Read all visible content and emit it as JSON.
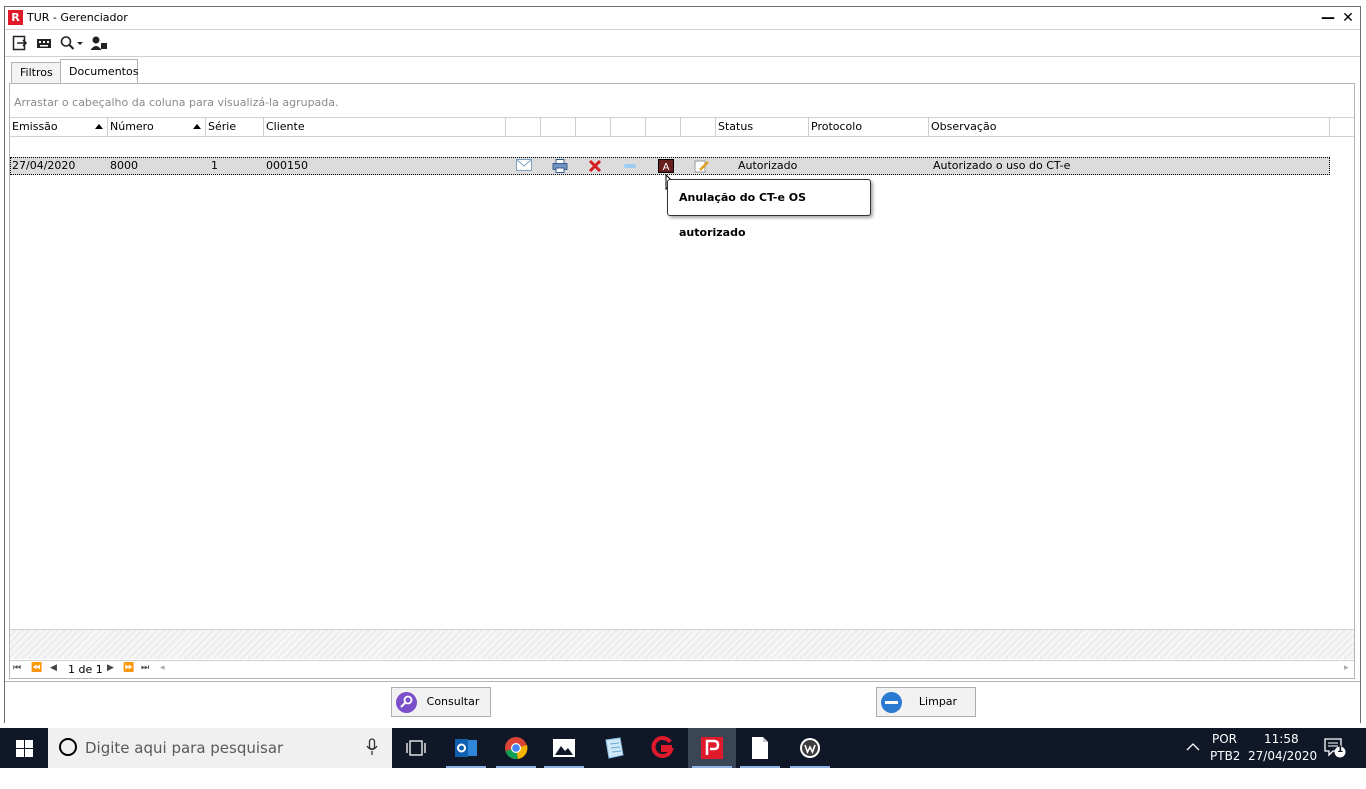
{
  "window": {
    "title": "TUR - Gerenciador",
    "app_icon": "R",
    "minimize": "—",
    "close": "✕"
  },
  "toolbar": {
    "icons": [
      "exit-icon",
      "keyboard-icon",
      "search-dropdown-icon",
      "user-icon"
    ]
  },
  "tabs": [
    {
      "label": "Filtros",
      "active": false
    },
    {
      "label": "Documentos",
      "active": true
    }
  ],
  "grid": {
    "group_hint": "Arrastar o cabeçalho da coluna para visualizá-la agrupada.",
    "columns": [
      "Emissão",
      "Número",
      "Série",
      "Cliente",
      "",
      "",
      "",
      "",
      "",
      "",
      "Status",
      "Protocolo",
      "Observação"
    ],
    "rows": [
      {
        "emissao": "27/04/2020",
        "numero": "8000",
        "serie": "1",
        "cliente": "000150",
        "status": "Autorizado",
        "protocolo": "",
        "observacao": "Autorizado o uso do CT-e"
      }
    ],
    "row_icons": [
      "email-icon",
      "print-icon",
      "cancel-icon",
      "link-icon",
      "annulment-icon",
      "edit-icon"
    ],
    "tooltip": "Anulação do CT-e OS autorizado",
    "pager": {
      "page_text": "1 de 1"
    }
  },
  "actions": {
    "consultar": "Consultar",
    "limpar": "Limpar"
  },
  "taskbar": {
    "search_placeholder": "Digite aqui para pesquisar",
    "lang_top": "POR",
    "lang_bottom": "PTB2",
    "time": "11:58",
    "date": "27/04/2020",
    "notifications": "1"
  },
  "colors": {
    "brand_red": "#e0192b",
    "row_selected": "#dcdcdc",
    "taskbar_bg": "#101828"
  }
}
